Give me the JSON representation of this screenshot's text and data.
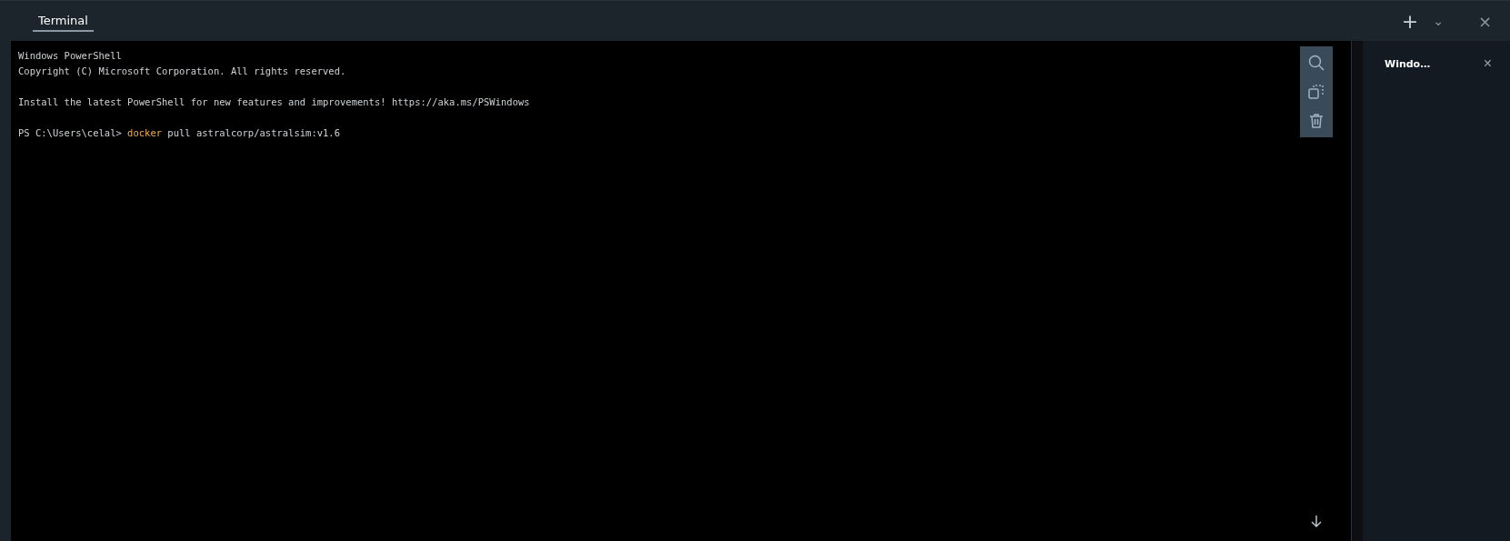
{
  "tabs": [
    {
      "label": "Terminal",
      "selected": true
    }
  ],
  "header_actions": {
    "add": "+",
    "dropdown": "⌄",
    "close": "×"
  },
  "terminal": {
    "lines": [
      {
        "kind": "text",
        "segments": [
          {
            "kind": "plain",
            "text": "Windows PowerShell"
          }
        ]
      },
      {
        "kind": "text",
        "segments": [
          {
            "kind": "plain",
            "text": "Copyright (C) Microsoft Corporation. All rights reserved."
          }
        ]
      },
      {
        "kind": "blank"
      },
      {
        "kind": "text",
        "segments": [
          {
            "kind": "plain",
            "text": "Install the latest PowerShell for new features and improvements! https://aka.ms/PSWindows"
          }
        ]
      },
      {
        "kind": "blank"
      },
      {
        "kind": "text",
        "segments": [
          {
            "kind": "plain",
            "text": "PS C:\\Users\\celal> "
          },
          {
            "kind": "command",
            "text": "docker"
          },
          {
            "kind": "plain",
            "text": " pull astralcorp/astralsim:v1.6"
          }
        ]
      }
    ]
  },
  "side_panel": {
    "items": [
      {
        "label": "Windo…",
        "close": "×",
        "selected": true
      }
    ]
  }
}
